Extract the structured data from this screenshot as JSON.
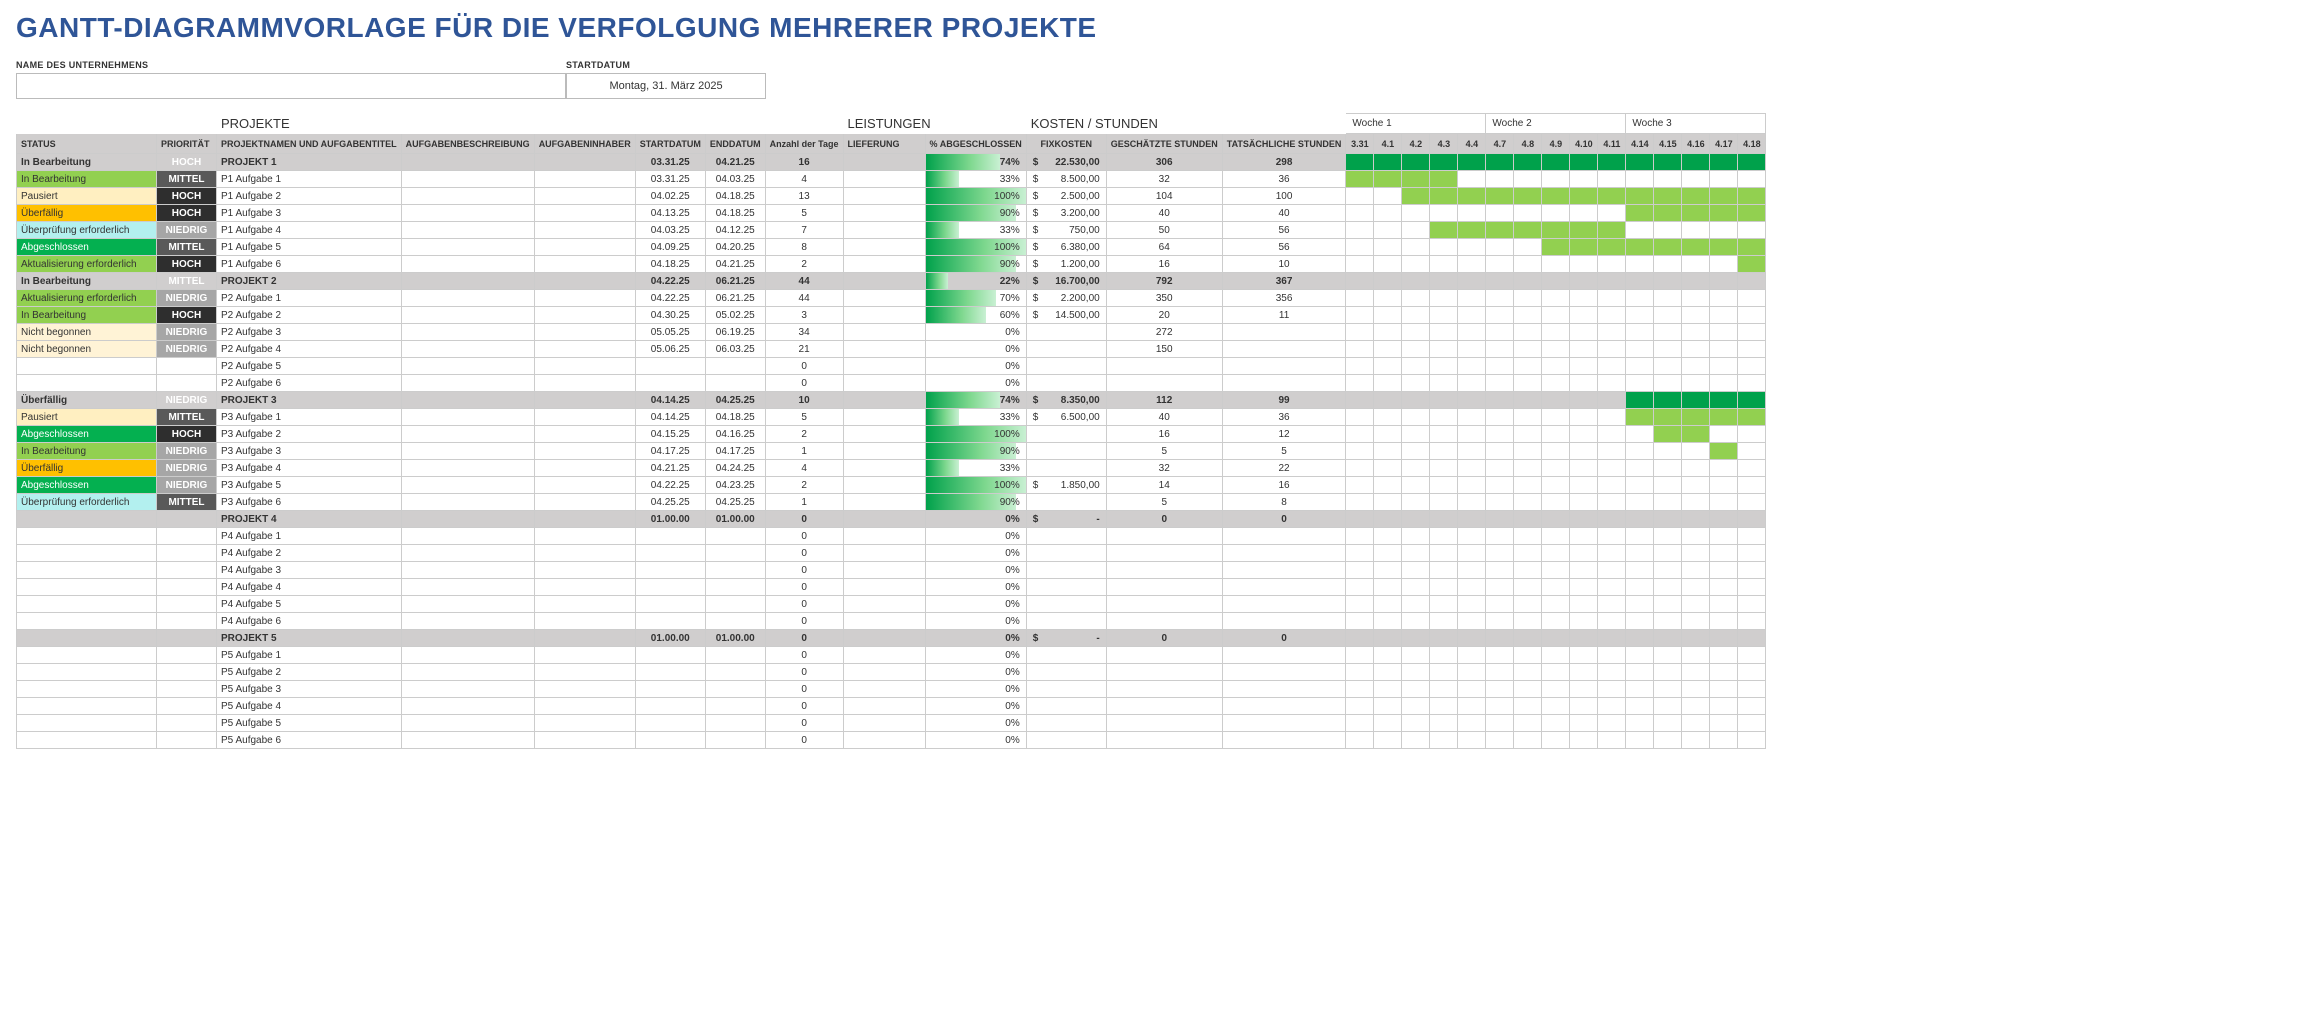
{
  "title": "GANTT-DIAGRAMMVORLAGE FÜR DIE VERFOLGUNG MEHRERER PROJEKTE",
  "labels": {
    "company": "NAME DES UNTERNEHMENS",
    "startdate": "STARTDATUM",
    "startdate_value": "Montag, 31. März 2025",
    "sec_projekte": "PROJEKTE",
    "sec_leistungen": "LEISTUNGEN",
    "sec_kosten": "KOSTEN / STUNDEN"
  },
  "columns": {
    "status": "STATUS",
    "priority": "PRIORITÄT",
    "name": "PROJEKTNAMEN UND AUFGABENTITEL",
    "desc": "AUFGABENBESCHREIBUNG",
    "owner": "AUFGABENINHABER",
    "start": "STARTDATUM",
    "end": "ENDDATUM",
    "days": "Anzahl der Tage",
    "deliver": "LIEFERUNG",
    "pct": "% ABGESCHLOSSEN",
    "fixed": "FIXKOSTEN",
    "est": "GESCHÄTZTE STUNDEN",
    "act": "TATSÄCHLICHE STUNDEN"
  },
  "weeks": [
    "Woche 1",
    "Woche 2",
    "Woche 3"
  ],
  "day_headers": [
    "3.31",
    "4.1",
    "4.2",
    "4.3",
    "4.4",
    "4.7",
    "4.8",
    "4.9",
    "4.10",
    "4.11",
    "4.14",
    "4.15",
    "4.16",
    "4.17",
    "4.18"
  ],
  "rows": [
    {
      "type": "project",
      "status": "In Bearbeitung",
      "st": "inprog",
      "priority": "HOCH",
      "pr": "hoch",
      "name": "PROJEKT 1",
      "start": "03.31.25",
      "end": "04.21.25",
      "days": "16",
      "pct": 74,
      "fixed": "22.530,00",
      "est": "306",
      "act": "298",
      "gstart": 0,
      "gend": 15,
      "shade": "dk"
    },
    {
      "type": "task",
      "status": "In Bearbeitung",
      "st": "inprog",
      "priority": "MITTEL",
      "pr": "mittel",
      "name": "P1 Aufgabe 1",
      "start": "03.31.25",
      "end": "04.03.25",
      "days": "4",
      "pct": 33,
      "fixed": "8.500,00",
      "est": "32",
      "act": "36",
      "gstart": 0,
      "gend": 4,
      "shade": "lt"
    },
    {
      "type": "task",
      "status": "Pausiert",
      "st": "paused",
      "priority": "HOCH",
      "pr": "hoch",
      "name": "P1 Aufgabe 2",
      "start": "04.02.25",
      "end": "04.18.25",
      "days": "13",
      "pct": 100,
      "fixed": "2.500,00",
      "est": "104",
      "act": "100",
      "gstart": 2,
      "gend": 15,
      "shade": "lt"
    },
    {
      "type": "task",
      "status": "Überfällig",
      "st": "overdue",
      "priority": "HOCH",
      "pr": "hoch",
      "name": "P1 Aufgabe 3",
      "start": "04.13.25",
      "end": "04.18.25",
      "days": "5",
      "pct": 90,
      "fixed": "3.200,00",
      "est": "40",
      "act": "40",
      "gstart": 10,
      "gend": 15,
      "shade": "lt"
    },
    {
      "type": "task",
      "status": "Überprüfung erforderlich",
      "st": "review",
      "priority": "NIEDRIG",
      "pr": "niedrig",
      "name": "P1 Aufgabe 4",
      "start": "04.03.25",
      "end": "04.12.25",
      "days": "7",
      "pct": 33,
      "fixed": "750,00",
      "est": "50",
      "act": "56",
      "gstart": 3,
      "gend": 10,
      "shade": "lt"
    },
    {
      "type": "task",
      "status": "Abgeschlossen",
      "st": "done",
      "priority": "MITTEL",
      "pr": "mittel",
      "name": "P1 Aufgabe 5",
      "start": "04.09.25",
      "end": "04.20.25",
      "days": "8",
      "pct": 100,
      "fixed": "6.380,00",
      "est": "64",
      "act": "56",
      "gstart": 7,
      "gend": 15,
      "shade": "lt"
    },
    {
      "type": "task",
      "status": "Aktualisierung erforderlich",
      "st": "update",
      "priority": "HOCH",
      "pr": "hoch",
      "name": "P1 Aufgabe 6",
      "start": "04.18.25",
      "end": "04.21.25",
      "days": "2",
      "pct": 90,
      "fixed": "1.200,00",
      "est": "16",
      "act": "10",
      "gstart": 14,
      "gend": 15,
      "shade": "lt"
    },
    {
      "type": "project",
      "status": "In Bearbeitung",
      "st": "inprog",
      "priority": "MITTEL",
      "pr": "mittel",
      "name": "PROJEKT 2",
      "start": "04.22.25",
      "end": "06.21.25",
      "days": "44",
      "pct": 22,
      "fixed": "16.700,00",
      "est": "792",
      "act": "367"
    },
    {
      "type": "task",
      "status": "Aktualisierung erforderlich",
      "st": "update",
      "priority": "NIEDRIG",
      "pr": "niedrig",
      "name": "P2 Aufgabe 1",
      "start": "04.22.25",
      "end": "06.21.25",
      "days": "44",
      "pct": 70,
      "fixed": "2.200,00",
      "est": "350",
      "act": "356"
    },
    {
      "type": "task",
      "status": "In Bearbeitung",
      "st": "inprog",
      "priority": "HOCH",
      "pr": "hoch",
      "name": "P2 Aufgabe 2",
      "start": "04.30.25",
      "end": "05.02.25",
      "days": "3",
      "pct": 60,
      "fixed": "14.500,00",
      "est": "20",
      "act": "11"
    },
    {
      "type": "task",
      "status": "Nicht begonnen",
      "st": "notstart",
      "priority": "NIEDRIG",
      "pr": "niedrig",
      "name": "P2 Aufgabe 3",
      "start": "05.05.25",
      "end": "06.19.25",
      "days": "34",
      "pct": 0,
      "est": "272"
    },
    {
      "type": "task",
      "status": "Nicht begonnen",
      "st": "notstart",
      "priority": "NIEDRIG",
      "pr": "niedrig",
      "name": "P2 Aufgabe 4",
      "start": "05.06.25",
      "end": "06.03.25",
      "days": "21",
      "pct": 0,
      "est": "150"
    },
    {
      "type": "task",
      "name": "P2 Aufgabe 5",
      "days": "0",
      "pct": 0
    },
    {
      "type": "task",
      "name": "P2 Aufgabe 6",
      "days": "0",
      "pct": 0
    },
    {
      "type": "project",
      "status": "Überfällig",
      "st": "overdue",
      "priority": "NIEDRIG",
      "pr": "niedrig",
      "name": "PROJEKT 3",
      "start": "04.14.25",
      "end": "04.25.25",
      "days": "10",
      "pct": 74,
      "fixed": "8.350,00",
      "est": "112",
      "act": "99",
      "gstart": 10,
      "gend": 15,
      "shade": "dk"
    },
    {
      "type": "task",
      "status": "Pausiert",
      "st": "paused",
      "priority": "MITTEL",
      "pr": "mittel",
      "name": "P3 Aufgabe 1",
      "start": "04.14.25",
      "end": "04.18.25",
      "days": "5",
      "pct": 33,
      "fixed": "6.500,00",
      "est": "40",
      "act": "36",
      "gstart": 10,
      "gend": 15,
      "shade": "lt"
    },
    {
      "type": "task",
      "status": "Abgeschlossen",
      "st": "done",
      "priority": "HOCH",
      "pr": "hoch",
      "name": "P3 Aufgabe 2",
      "start": "04.15.25",
      "end": "04.16.25",
      "days": "2",
      "pct": 100,
      "est": "16",
      "act": "12",
      "gstart": 11,
      "gend": 13,
      "shade": "lt"
    },
    {
      "type": "task",
      "status": "In Bearbeitung",
      "st": "inprog",
      "priority": "NIEDRIG",
      "pr": "niedrig",
      "name": "P3 Aufgabe 3",
      "start": "04.17.25",
      "end": "04.17.25",
      "days": "1",
      "pct": 90,
      "est": "5",
      "act": "5",
      "gstart": 13,
      "gend": 14,
      "shade": "lt"
    },
    {
      "type": "task",
      "status": "Überfällig",
      "st": "overdue",
      "priority": "NIEDRIG",
      "pr": "niedrig",
      "name": "P3 Aufgabe 4",
      "start": "04.21.25",
      "end": "04.24.25",
      "days": "4",
      "pct": 33,
      "est": "32",
      "act": "22"
    },
    {
      "type": "task",
      "status": "Abgeschlossen",
      "st": "done",
      "priority": "NIEDRIG",
      "pr": "niedrig",
      "name": "P3 Aufgabe 5",
      "start": "04.22.25",
      "end": "04.23.25",
      "days": "2",
      "pct": 100,
      "fixed": "1.850,00",
      "est": "14",
      "act": "16"
    },
    {
      "type": "task",
      "status": "Überprüfung erforderlich",
      "st": "review",
      "priority": "MITTEL",
      "pr": "mittel",
      "name": "P3 Aufgabe 6",
      "start": "04.25.25",
      "end": "04.25.25",
      "days": "1",
      "pct": 90,
      "est": "5",
      "act": "8"
    },
    {
      "type": "project",
      "name": "PROJEKT 4",
      "start": "01.00.00",
      "end": "01.00.00",
      "days": "0",
      "pct": 0,
      "fixed": "-",
      "est": "0",
      "act": "0"
    },
    {
      "type": "task",
      "name": "P4 Aufgabe 1",
      "days": "0",
      "pct": 0
    },
    {
      "type": "task",
      "name": "P4 Aufgabe 2",
      "days": "0",
      "pct": 0
    },
    {
      "type": "task",
      "name": "P4 Aufgabe 3",
      "days": "0",
      "pct": 0
    },
    {
      "type": "task",
      "name": "P4 Aufgabe 4",
      "days": "0",
      "pct": 0
    },
    {
      "type": "task",
      "name": "P4 Aufgabe 5",
      "days": "0",
      "pct": 0
    },
    {
      "type": "task",
      "name": "P4 Aufgabe 6",
      "days": "0",
      "pct": 0
    },
    {
      "type": "project",
      "name": "PROJEKT 5",
      "start": "01.00.00",
      "end": "01.00.00",
      "days": "0",
      "pct": 0,
      "fixed": "-",
      "est": "0",
      "act": "0"
    },
    {
      "type": "task",
      "name": "P5 Aufgabe 1",
      "days": "0",
      "pct": 0
    },
    {
      "type": "task",
      "name": "P5 Aufgabe 2",
      "days": "0",
      "pct": 0
    },
    {
      "type": "task",
      "name": "P5 Aufgabe 3",
      "days": "0",
      "pct": 0
    },
    {
      "type": "task",
      "name": "P5 Aufgabe 4",
      "days": "0",
      "pct": 0
    },
    {
      "type": "task",
      "name": "P5 Aufgabe 5",
      "days": "0",
      "pct": 0
    },
    {
      "type": "task",
      "name": "P5 Aufgabe 6",
      "days": "0",
      "pct": 0
    }
  ]
}
